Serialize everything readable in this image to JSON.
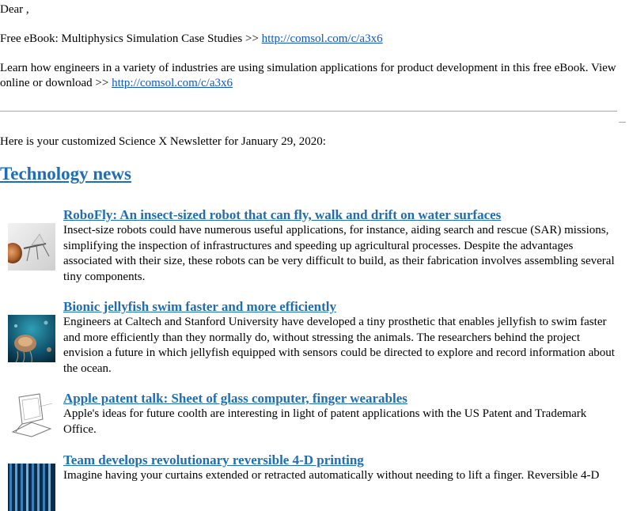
{
  "greeting": "Dear ,",
  "promo": {
    "headline_prefix": "Free eBook: Multiphysics Simulation Case Studies >> ",
    "headline_link": "http://comsol.com/c/a3x6",
    "body_prefix": "Learn how engineers in a variety of industries are using simulation applications for product development in this free eBook. View online or download >> ",
    "body_link": "http://comsol.com/c/a3x6"
  },
  "intro": "Here is your customized Science X Newsletter for January 29, 2020:",
  "section": {
    "title": "Technology news"
  },
  "articles": [
    {
      "title": "RoboFly: An insect-sized robot that can fly, walk and drift on water surfaces",
      "summary": "Insect-size robots could have numerous useful applications, for instance, aiding search and rescue (SAR) missions, simplifying the inspection of infrastructures and speeding up agricultural processes. Despite the advantages associated with their size, these robots can be very difficult to build, as their fabrication involves assembling several tiny components.",
      "thumb": "robofly-photo"
    },
    {
      "title": "Bionic jellyfish swim faster and more efficiently",
      "summary": "Engineers at Caltech and Stanford University have developed a tiny prosthetic that enables jellyfish to swim faster and more efficiently than they normally do, without stressing the animals. The researchers behind the project envision a future in which jellyfish equipped with sensors could be directed to explore and record information about the ocean.",
      "thumb": "jellyfish-photo"
    },
    {
      "title": "Apple patent talk: Sheet of glass computer, finger wearables",
      "summary": "Apple's ideas for future coolth are interesting in light of patent applications with the US Patent and Trademark Office.",
      "thumb": "patent-drawing"
    },
    {
      "title": "Team develops revolutionary reversible 4-D printing",
      "summary": "Imagine having your curtains extended or retracted automatically without needing to lift a finger. Reversible 4-D",
      "thumb": "printing-photo"
    }
  ],
  "colors": {
    "link": "#1155cc",
    "headline": "#1f6db5",
    "rule": "#a8a8a8"
  }
}
